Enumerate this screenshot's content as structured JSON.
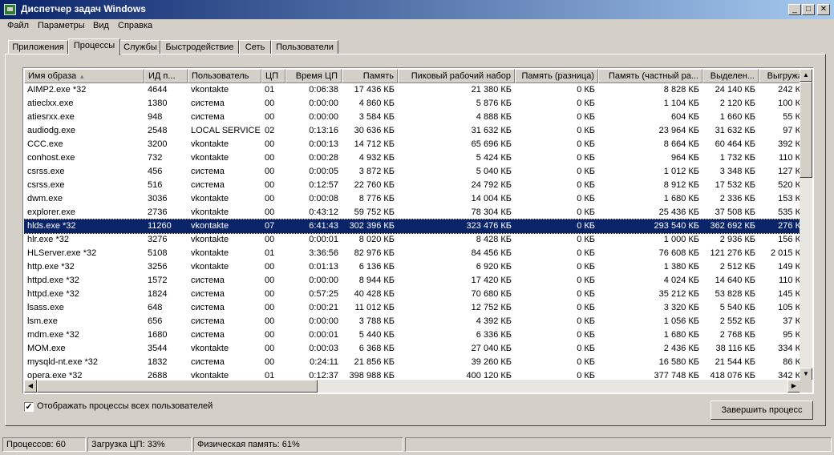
{
  "window": {
    "title": "Диспетчер задач Windows",
    "min": "_",
    "max": "□",
    "close": "✕"
  },
  "menu": [
    "Файл",
    "Параметры",
    "Вид",
    "Справка"
  ],
  "tabs": [
    "Приложения",
    "Процессы",
    "Службы",
    "Быстродействие",
    "Сеть",
    "Пользователи"
  ],
  "active_tab": "Процессы",
  "columns": [
    "Имя образа",
    "ИД п...",
    "Пользователь",
    "ЦП",
    "Время ЦП",
    "Память",
    "Пиковый рабочий набор",
    "Память (разница)",
    "Память (частный ра...",
    "Выделен...",
    "Выгружа"
  ],
  "sort_indicator": "▲",
  "rows": [
    [
      "AIMP2.exe *32",
      "4644",
      "vkontakte",
      "01",
      "0:06:38",
      "17 436 КБ",
      "21 380 КБ",
      "0 КБ",
      "8 828 КБ",
      "24 140 КБ",
      "242 К"
    ],
    [
      "atieclxx.exe",
      "1380",
      "система",
      "00",
      "0:00:00",
      "4 860 КБ",
      "5 876 КБ",
      "0 КБ",
      "1 104 КБ",
      "2 120 КБ",
      "100 К"
    ],
    [
      "atiesrxx.exe",
      "948",
      "система",
      "00",
      "0:00:00",
      "3 584 КБ",
      "4 888 КБ",
      "0 КБ",
      "604 КБ",
      "1 660 КБ",
      "55 К"
    ],
    [
      "audiodg.exe",
      "2548",
      "LOCAL SERVICE",
      "02",
      "0:13:16",
      "30 636 КБ",
      "31 632 КБ",
      "0 КБ",
      "23 964 КБ",
      "31 632 КБ",
      "97 К"
    ],
    [
      "CCC.exe",
      "3200",
      "vkontakte",
      "00",
      "0:00:13",
      "14 712 КБ",
      "65 696 КБ",
      "0 КБ",
      "8 664 КБ",
      "60 464 КБ",
      "392 К"
    ],
    [
      "conhost.exe",
      "732",
      "vkontakte",
      "00",
      "0:00:28",
      "4 932 КБ",
      "5 424 КБ",
      "0 КБ",
      "964 КБ",
      "1 732 КБ",
      "110 К"
    ],
    [
      "csrss.exe",
      "456",
      "система",
      "00",
      "0:00:05",
      "3 872 КБ",
      "5 040 КБ",
      "0 КБ",
      "1 012 КБ",
      "3 348 КБ",
      "127 К"
    ],
    [
      "csrss.exe",
      "516",
      "система",
      "00",
      "0:12:57",
      "22 760 КБ",
      "24 792 КБ",
      "0 КБ",
      "8 912 КБ",
      "17 532 КБ",
      "520 К"
    ],
    [
      "dwm.exe",
      "3036",
      "vkontakte",
      "00",
      "0:00:08",
      "8 776 КБ",
      "14 004 КБ",
      "0 КБ",
      "1 680 КБ",
      "2 336 КБ",
      "153 К"
    ],
    [
      "explorer.exe",
      "2736",
      "vkontakte",
      "00",
      "0:43:12",
      "59 752 КБ",
      "78 304 КБ",
      "0 КБ",
      "25 436 КБ",
      "37 508 КБ",
      "535 К"
    ],
    [
      "hlds.exe *32",
      "11260",
      "vkontakte",
      "07",
      "6:41:43",
      "302 396 КБ",
      "323 476 КБ",
      "0 КБ",
      "293 540 КБ",
      "362 692 КБ",
      "276 К"
    ],
    [
      "hlr.exe *32",
      "3276",
      "vkontakte",
      "00",
      "0:00:01",
      "8 020 КБ",
      "8 428 КБ",
      "0 КБ",
      "1 000 КБ",
      "2 936 КБ",
      "156 К"
    ],
    [
      "HLServer.exe *32",
      "5108",
      "vkontakte",
      "01",
      "3:36:56",
      "82 976 КБ",
      "84 456 КБ",
      "0 КБ",
      "76 608 КБ",
      "121 276 КБ",
      "2 015 К"
    ],
    [
      "http.exe *32",
      "3256",
      "vkontakte",
      "00",
      "0:01:13",
      "6 136 КБ",
      "6 920 КБ",
      "0 КБ",
      "1 380 КБ",
      "2 512 КБ",
      "149 К"
    ],
    [
      "httpd.exe *32",
      "1572",
      "система",
      "00",
      "0:00:00",
      "8 944 КБ",
      "17 420 КБ",
      "0 КБ",
      "4 024 КБ",
      "14 640 КБ",
      "110 К"
    ],
    [
      "httpd.exe *32",
      "1824",
      "система",
      "00",
      "0:57:25",
      "40 428 КБ",
      "70 680 КБ",
      "0 КБ",
      "35 212 КБ",
      "53 828 КБ",
      "145 К"
    ],
    [
      "lsass.exe",
      "648",
      "система",
      "00",
      "0:00:21",
      "11 012 КБ",
      "12 752 КБ",
      "0 КБ",
      "3 320 КБ",
      "5 540 КБ",
      "105 К"
    ],
    [
      "lsm.exe",
      "656",
      "система",
      "00",
      "0:00:00",
      "3 788 КБ",
      "4 392 КБ",
      "0 КБ",
      "1 056 КБ",
      "2 552 КБ",
      "37 К"
    ],
    [
      "mdm.exe *32",
      "1680",
      "система",
      "00",
      "0:00:01",
      "5 440 КБ",
      "6 336 КБ",
      "0 КБ",
      "1 680 КБ",
      "2 768 КБ",
      "95 К"
    ],
    [
      "MOM.exe",
      "3544",
      "vkontakte",
      "00",
      "0:00:03",
      "6 368 КБ",
      "27 040 КБ",
      "0 КБ",
      "2 436 КБ",
      "38 116 КБ",
      "334 К"
    ],
    [
      "mysqld-nt.exe *32",
      "1832",
      "система",
      "00",
      "0:24:11",
      "21 856 КБ",
      "39 260 КБ",
      "0 КБ",
      "16 580 КБ",
      "21 544 КБ",
      "86 К"
    ],
    [
      "opera.exe *32",
      "2688",
      "vkontakte",
      "01",
      "0:12:37",
      "398 988 КБ",
      "400 120 КБ",
      "0 КБ",
      "377 748 КБ",
      "418 076 КБ",
      "342 К"
    ]
  ],
  "selected_row": 10,
  "checkbox": {
    "label": "Отображать процессы всех пользователей",
    "checked": "✓"
  },
  "end_button": "Завершить процесс",
  "status": [
    "Процессов: 60",
    "Загрузка ЦП: 33%",
    "Физическая память: 61%"
  ],
  "colors": {
    "title_start": "#0a246a",
    "title_end": "#a6caf0",
    "selection": "#0a246a",
    "face": "#d4d0c8"
  }
}
